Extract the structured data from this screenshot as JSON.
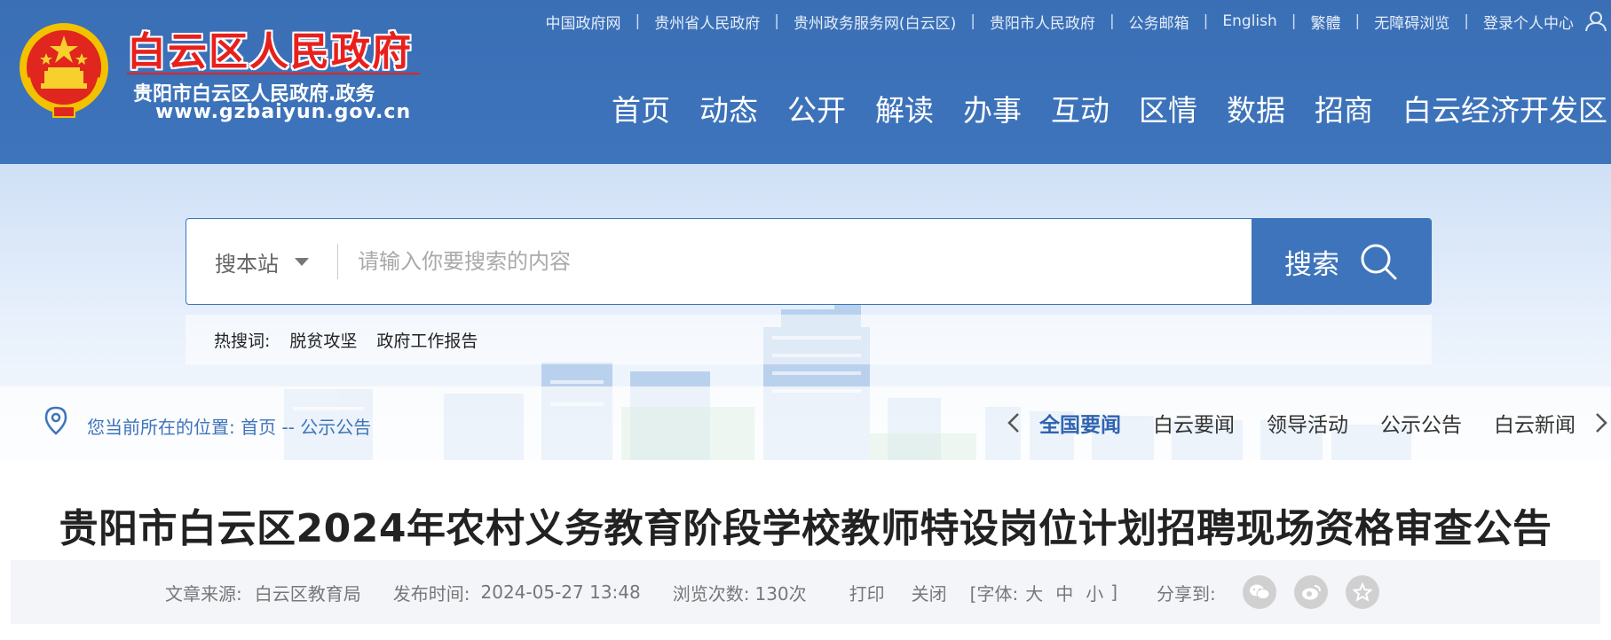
{
  "site": {
    "title": "白云区人民政府",
    "subtitle": "贵阳市白云区人民政府.政务",
    "url": "www.gzbaiyun.gov.cn",
    "brand_color": "#3e74bb",
    "title_color": "#e8201c"
  },
  "toplinks": [
    "中国政府网",
    "贵州省人民政府",
    "贵州政务服务网(白云区)",
    "贵阳市人民政府",
    "公务邮箱",
    "English",
    "繁體",
    "无障碍浏览",
    "登录个人中心"
  ],
  "nav": [
    "首页",
    "动态",
    "公开",
    "解读",
    "办事",
    "互动",
    "区情",
    "数据",
    "招商",
    "白云经济开发区"
  ],
  "search": {
    "scope": "搜本站",
    "placeholder": "请输入你要搜索的内容",
    "button": "搜索"
  },
  "hot": {
    "label": "热搜词:",
    "items": [
      "脱贫攻坚",
      "政府工作报告"
    ]
  },
  "breadcrumb": {
    "prefix": "您当前所在的位置:",
    "home": "首页",
    "sep": "--",
    "current": "公示公告"
  },
  "tabs": [
    {
      "label": "全国要闻",
      "active": true
    },
    {
      "label": "白云要闻",
      "active": false
    },
    {
      "label": "领导活动",
      "active": false
    },
    {
      "label": "公示公告",
      "active": false
    },
    {
      "label": "白云新闻",
      "active": false
    }
  ],
  "article": {
    "title": "贵阳市白云区2024年农村义务教育阶段学校教师特设岗位计划招聘现场资格审查公告",
    "source_label": "文章来源:",
    "source": "白云区教育局",
    "time_label": "发布时间:",
    "time": "2024-05-27 13:48",
    "views_label": "浏览次数:",
    "views": "130次",
    "print": "打印",
    "close": "关闭",
    "font_open": "[字体:",
    "font_large": "大",
    "font_medium": "中",
    "font_small": "小",
    "font_close": "]",
    "share_label": "分享到:",
    "share_icons": [
      "wechat-icon",
      "weibo-icon",
      "star-icon"
    ]
  }
}
